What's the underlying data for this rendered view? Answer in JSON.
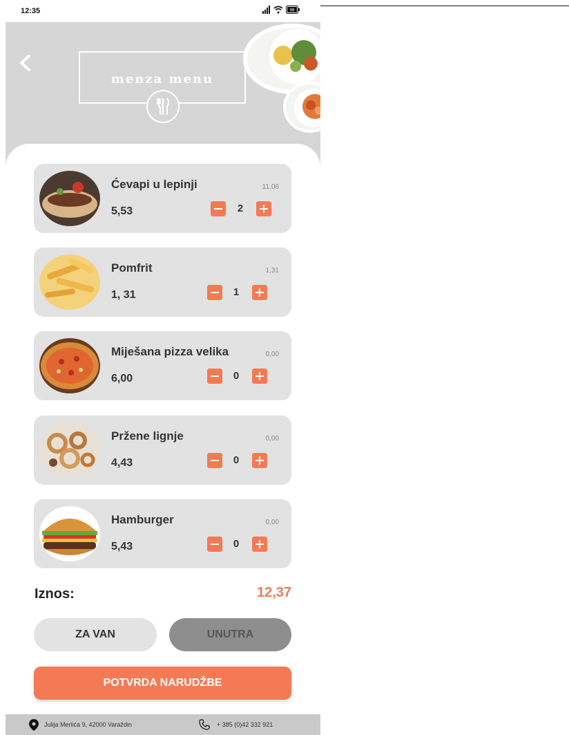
{
  "status": {
    "time": "12:35",
    "battery": "99"
  },
  "header": {
    "logo_text": "menza menu"
  },
  "items": [
    {
      "name": "Ćevapi u lepinji",
      "price": "5,53",
      "total": "11,06",
      "qty": "2"
    },
    {
      "name": "Pomfrit",
      "price": "1, 31",
      "total": "1,31",
      "qty": "1"
    },
    {
      "name": "Miješana pizza velika",
      "price": "6,00",
      "total": "0,00",
      "qty": "0"
    },
    {
      "name": "Pržene lignje",
      "price": "4,43",
      "total": "0,00",
      "qty": "0"
    },
    {
      "name": "Hamburger",
      "price": "5,43",
      "total": "0,00",
      "qty": "0"
    }
  ],
  "summary": {
    "label": "Iznos:",
    "value": "12,37"
  },
  "order_type": {
    "takeaway": "ZA VAN",
    "dine_in": "UNUTRA",
    "selected": "UNUTRA"
  },
  "confirm_label": "POTVRDA NARUDŽBE",
  "footer": {
    "address": "Julija Merlića 9, 42000 Varaždin",
    "phone": "+ 385 (0)42 332 921"
  },
  "colors": {
    "accent": "#f47a56",
    "header_bg": "#d6d6d6",
    "card_bg": "#e2e2e2",
    "selected_toggle": "#8e8e8e"
  },
  "icons": [
    "back-chevron-icon",
    "cutlery-icon",
    "minus-icon",
    "plus-icon",
    "location-pin-icon",
    "phone-icon",
    "signal-icon",
    "wifi-icon",
    "battery-icon"
  ]
}
